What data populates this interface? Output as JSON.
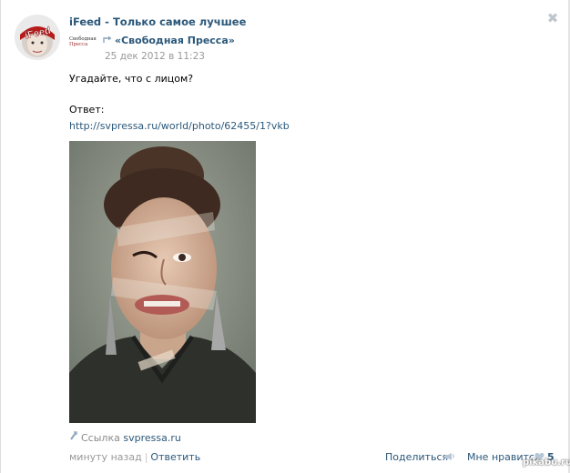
{
  "post": {
    "author": "iFeed - Только самое лучшее",
    "source_name": "«Свободная Пресса»",
    "source_logo": [
      "Свободная",
      "Пресса"
    ],
    "date": "25 дек 2012 в 11:23",
    "text": "Угадайте, что с лицом?",
    "answer_label": "Ответ:",
    "answer_link": "http://svpressa.ru/world/photo/62455/1?vkb",
    "link_label": "Ссылка",
    "link_domain": "svpressa.ru"
  },
  "footer": {
    "time": "минуту назад",
    "separator": "|",
    "reply": "Ответить",
    "share": "Поделиться",
    "like": "Мне нравится",
    "like_count": "5"
  },
  "avatar_text": "iFeed",
  "close_glyph": "✖",
  "watermark": "pikabu.ru",
  "colors": {
    "link": "#2b587a",
    "muted": "#999999"
  },
  "icons": [
    "avatar-ifeed",
    "close-icon",
    "repost-icon",
    "link-icon",
    "share-icon",
    "heart-icon"
  ]
}
